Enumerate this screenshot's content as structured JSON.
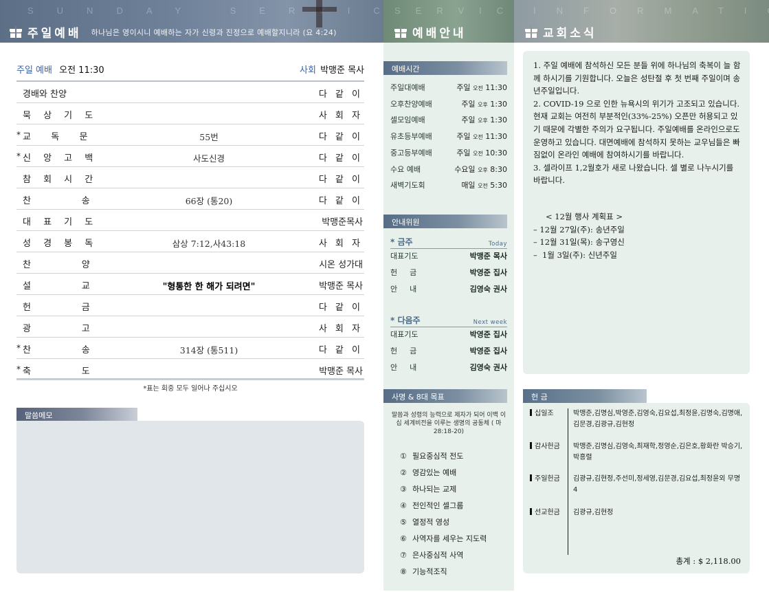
{
  "header": {
    "left": {
      "eng": "SUNDAY SERVICE",
      "title": "주일예배",
      "subtitle": "하나님은 영이시니 예배하는 자가 신령과 진정으로 예배할지니라 (요 4:24)"
    },
    "middle": {
      "eng": "SERVICE",
      "title": "예배안내"
    },
    "right": {
      "eng": "INFORMATION",
      "title": "교회소식"
    }
  },
  "service": {
    "time_label": "주일 예배",
    "time": "오전 11:30",
    "host_label": "사회",
    "host": "박맹준 목사",
    "rows": [
      {
        "star": "",
        "name": "경배와 찬양",
        "mid": "",
        "who": "다 같 이"
      },
      {
        "star": "",
        "name": "묵 상 기 도",
        "mid": "",
        "who": "사 회 자"
      },
      {
        "star": "*",
        "name": "교  독  문",
        "mid": "55번",
        "who": "다 같 이"
      },
      {
        "star": "*",
        "name": "신 앙 고 백",
        "mid": "사도신경",
        "who": "다 같 이"
      },
      {
        "star": "",
        "name": "참 회 시 간",
        "mid": "",
        "who": "다 같 이"
      },
      {
        "star": "",
        "name": "찬      송",
        "mid": "66장 (통20)",
        "who": "다 같 이"
      },
      {
        "star": "",
        "name": "대 표 기 도",
        "mid": "",
        "who": "박맹준목사"
      },
      {
        "star": "",
        "name": "성 경 봉 독",
        "mid": "삼상 7:12,사43:18",
        "who": "사 회 자"
      },
      {
        "star": "",
        "name": "찬      양",
        "mid": "",
        "who": "시온 성가대"
      },
      {
        "star": "",
        "name": "설      교",
        "mid": "\"형통한 한 해가 되려면\"",
        "who": "박맹준 목사"
      },
      {
        "star": "",
        "name": "헌      금",
        "mid": "",
        "who": "다 같 이"
      },
      {
        "star": "",
        "name": "광      고",
        "mid": "",
        "who": "사 회 자"
      },
      {
        "star": "*",
        "name": "찬      송",
        "mid": "314장 (통511)",
        "who": "다 같 이"
      },
      {
        "star": "*",
        "name": "축      도",
        "mid": "",
        "who": "박맹준 목사"
      }
    ],
    "footnote": "*표는 회중 모두 일어나 주십시오"
  },
  "memo": {
    "label": "말씀메모"
  },
  "schedule": {
    "label": "예배시간",
    "items": [
      {
        "name": "주일대예배",
        "day": "주일",
        "ampm": "오전",
        "time": "11:30"
      },
      {
        "name": "오후찬양예배",
        "day": "주일",
        "ampm": "오후",
        "time": "1:30"
      },
      {
        "name": "셀모임예배",
        "day": "주일",
        "ampm": "오후",
        "time": "1:30"
      },
      {
        "name": "유초등부예배",
        "day": "주일",
        "ampm": "오전",
        "time": "11:30"
      },
      {
        "name": "중고등부예배",
        "day": "주일",
        "ampm": "오전",
        "time": "10:30"
      },
      {
        "name": "수요 예배",
        "day": "수요일",
        "ampm": "오후",
        "time": "8:30"
      },
      {
        "name": "새벽기도회",
        "day": "매일",
        "ampm": "오전",
        "time": "5:30"
      }
    ]
  },
  "duty": {
    "label": "안내위원",
    "this_week": {
      "title": "* 금주",
      "en": "Today",
      "rows": [
        {
          "role": "대표기도",
          "name": "박맹준 목사"
        },
        {
          "role": "헌금",
          "name": "박영준 집사"
        },
        {
          "role": "안내",
          "name": "김영숙 권사"
        }
      ]
    },
    "next_week": {
      "title": "* 다음주",
      "en": "Next week",
      "rows": [
        {
          "role": "대표기도",
          "name": "박영준 집사"
        },
        {
          "role": "헌금",
          "name": "박영준 집사"
        },
        {
          "role": "안내",
          "name": "김영숙 권사"
        }
      ]
    }
  },
  "mission": {
    "label": "사명 & 8대 목표",
    "statement": "말씀과 성령의 능력으로 제자가 되어 이백 이십 세계비전을 이루는 생명의 공동체 ( 마 28:18-20)",
    "goals": [
      {
        "num": "①",
        "text": "필요중심적 전도"
      },
      {
        "num": "②",
        "text": "영감있는 예배"
      },
      {
        "num": "③",
        "text": "하나되는 교제"
      },
      {
        "num": "④",
        "text": "전인적인 셀그룹"
      },
      {
        "num": "⑤",
        "text": "열정적 영성"
      },
      {
        "num": "⑥",
        "text": "사역자를 세우는 지도력"
      },
      {
        "num": "⑦",
        "text": "은사중심적 사역"
      },
      {
        "num": "⑧",
        "text": "기능적조직"
      }
    ]
  },
  "news": {
    "paragraphs": [
      "1. 주일 예배에 참석하신 모든 분들 위에 하나님의 축복이 늘 함께 하시기를 기원합니다. 오늘은 성탄절 후 첫 번째 주일이며 송년주일입니다.",
      "2. COVID-19 으로 인한 뉴욕시의 위기가 고조되고 있습니다. 현재 교회는 여전히 부분적인(33%-25%) 오픈만 허용되고 있기 때문에 각별한 주의가 요구됩니다. 주일예배를 온라인으로도 운영하고 있습니다. 대면예배에 참석하지 못하는 교우님들은 빠짐없이 온라인 예배에 참여하시기를 바랍니다.",
      "3. 셀라이프 1,2월호가 새로 나왔습니다. 셀 별로 나누시기를 바랍니다."
    ],
    "events_title": "< 12월 행사 계획표 >",
    "events": [
      "– 12월 27일(주): 송년주일",
      "– 12월 31일(목): 송구영신",
      "–  1월 3일(주): 신년주일"
    ]
  },
  "offering": {
    "label": "헌 금",
    "rows": [
      {
        "cat": "십일조",
        "names": "박맹준,김명심,박영준,김영숙,김요섭,최정윤,김명숙,김명애,김문경,김광규,김현정"
      },
      {
        "cat": "감사헌금",
        "names": "박맹준,김명심,김영숙,최재학,정영순,김은호,황화란 박승기,박흥렬"
      },
      {
        "cat": "주일헌금",
        "names": "김광규,김현정,주선미,정세영,김문경,김요섭,최정윤외 무명4"
      },
      {
        "cat": "선교헌금",
        "names": "김광규,김현정"
      }
    ],
    "total": "총계 : $ 2,118.00"
  },
  "colors": {
    "accent_blue": "#3d64a8",
    "panel_green": "#e7f0ea",
    "memo_gray": "#e1e6ea"
  }
}
